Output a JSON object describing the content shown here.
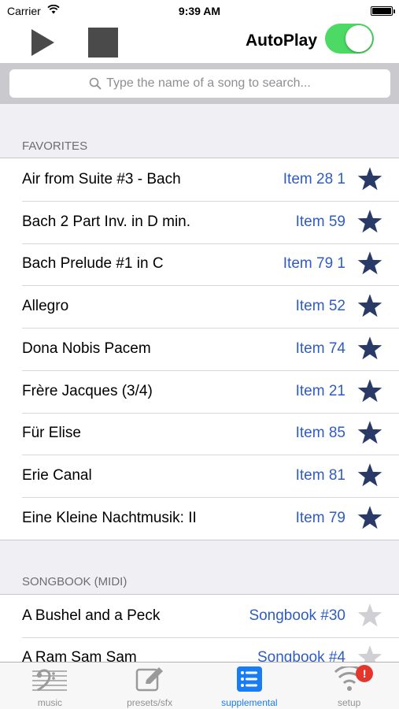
{
  "status": {
    "carrier": "Carrier",
    "time": "9:39 AM"
  },
  "toolbar": {
    "autoplay_label": "AutoPlay",
    "autoplay_on": true
  },
  "search": {
    "placeholder": "Type the name of a song to search..."
  },
  "colors": {
    "accent": "#2f5cc4",
    "star_on": "#2a3a66",
    "star_off": "#d0d0d4",
    "toggle_on": "#4cd964",
    "tab_active": "#1a7cf5",
    "badge": "#e3362c"
  },
  "sections": [
    {
      "header": "FAVORITES",
      "rows": [
        {
          "title": "Air from Suite #3 - Bach",
          "item": "Item 28 1",
          "favorite": true
        },
        {
          "title": "Bach 2 Part Inv. in D min.",
          "item": "Item 59",
          "favorite": true
        },
        {
          "title": "Bach Prelude #1 in C",
          "item": "Item 79 1",
          "favorite": true
        },
        {
          "title": "Allegro",
          "item": "Item 52",
          "favorite": true
        },
        {
          "title": "Dona Nobis Pacem",
          "item": "Item 74",
          "favorite": true
        },
        {
          "title": "Frère Jacques (3/4)",
          "item": "Item 21",
          "favorite": true
        },
        {
          "title": "Für Elise",
          "item": "Item 85",
          "favorite": true
        },
        {
          "title": "Erie Canal",
          "item": "Item 81",
          "favorite": true
        },
        {
          "title": "Eine Kleine Nachtmusik: II",
          "item": "Item 79",
          "favorite": true
        }
      ]
    },
    {
      "header": "SONGBOOK (MIDI)",
      "rows": [
        {
          "title": "A Bushel and a Peck",
          "item": "Songbook #30",
          "favorite": false
        },
        {
          "title": "A Ram Sam Sam",
          "item": "Songbook #4",
          "favorite": false
        }
      ]
    }
  ],
  "tabs": [
    {
      "label": "music",
      "icon": "bass-clef-staff-icon",
      "active": false
    },
    {
      "label": "presets/sfx",
      "icon": "edit-icon",
      "active": false
    },
    {
      "label": "supplemental",
      "icon": "list-icon",
      "active": true
    },
    {
      "label": "setup",
      "icon": "wifi-icon",
      "active": false,
      "badge": "!"
    }
  ]
}
